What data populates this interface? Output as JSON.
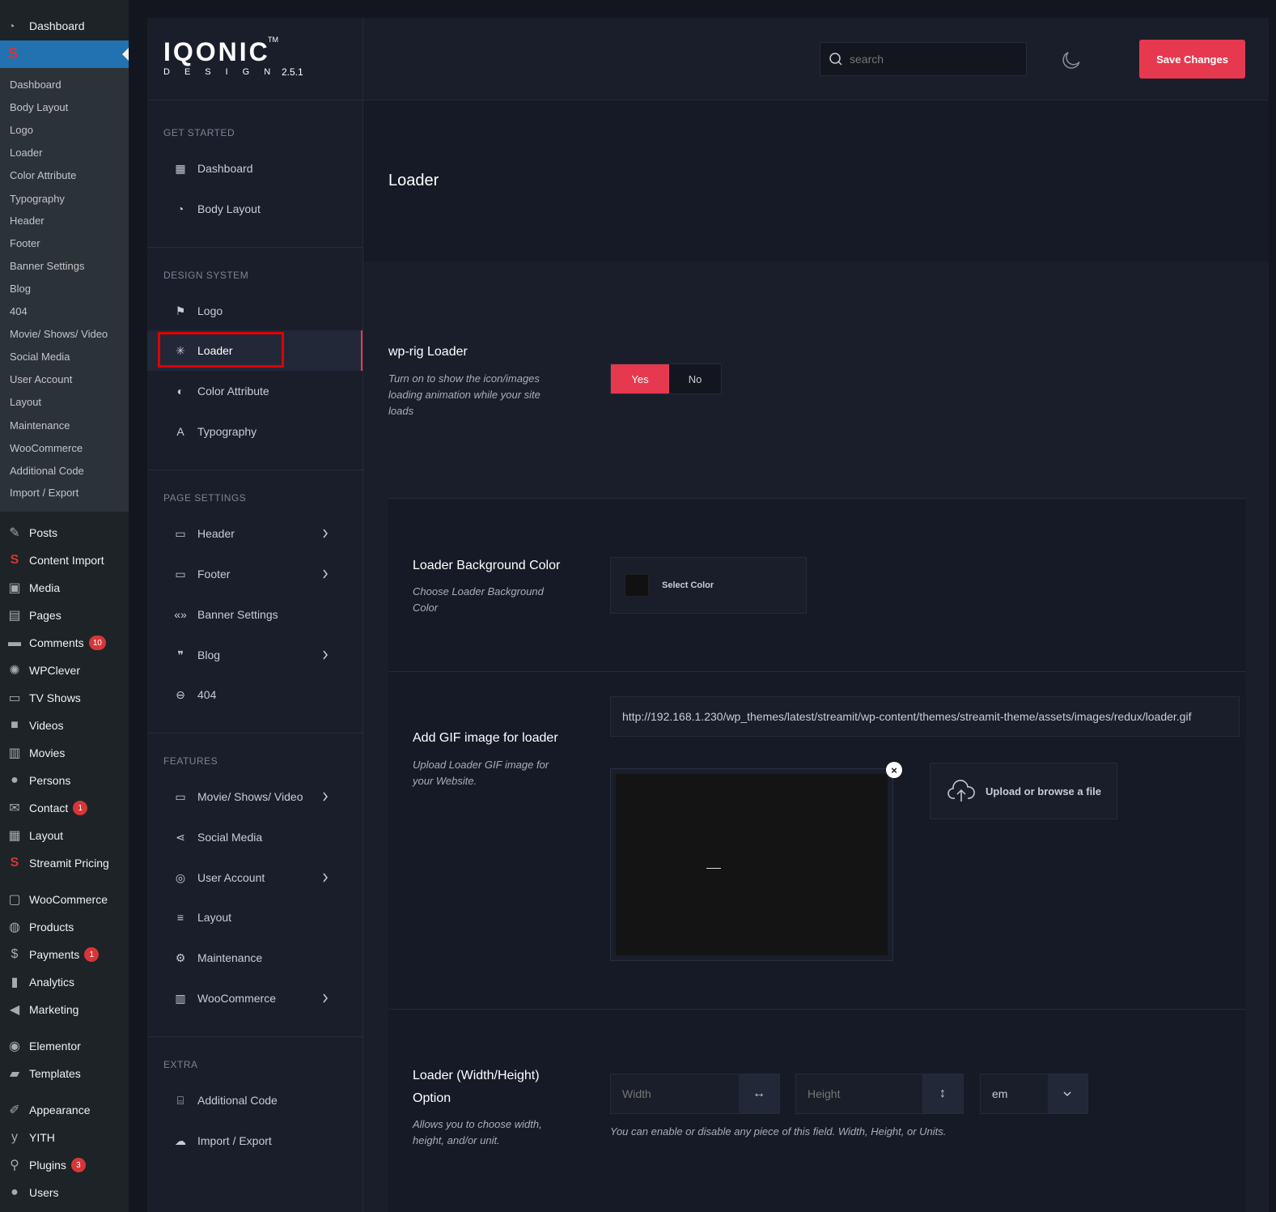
{
  "wp_sidebar": {
    "top_item": "Dashboard",
    "submenu": [
      "Dashboard",
      "Body Layout",
      "Logo",
      "Loader",
      "Color Attribute",
      "Typography",
      "Header",
      "Footer",
      "Banner Settings",
      "Blog",
      "404",
      "Movie/ Shows/ Video",
      "Social Media",
      "User Account",
      "Layout",
      "Maintenance",
      "WooCommerce",
      "Additional Code",
      "Import / Export"
    ],
    "menu": [
      {
        "label": "Posts",
        "icon": "pin-icon"
      },
      {
        "label": "Content Import",
        "icon": "streamit-icon"
      },
      {
        "label": "Media",
        "icon": "media-icon"
      },
      {
        "label": "Pages",
        "icon": "pages-icon"
      },
      {
        "label": "Comments",
        "icon": "comment-icon",
        "badge": "10"
      },
      {
        "label": "WPClever",
        "icon": "bulb-icon"
      },
      {
        "label": "TV Shows",
        "icon": "tv-icon"
      },
      {
        "label": "Videos",
        "icon": "video-icon"
      },
      {
        "label": "Movies",
        "icon": "film-icon"
      },
      {
        "label": "Persons",
        "icon": "person-icon"
      },
      {
        "label": "Contact",
        "icon": "mail-icon",
        "badge": "1"
      },
      {
        "label": "Layout",
        "icon": "layout-icon"
      },
      {
        "label": "Streamit Pricing",
        "icon": "streamit-icon"
      },
      {
        "label": "WooCommerce",
        "icon": "woo-icon"
      },
      {
        "label": "Products",
        "icon": "products-icon"
      },
      {
        "label": "Payments",
        "icon": "payments-icon",
        "badge": "1"
      },
      {
        "label": "Analytics",
        "icon": "analytics-icon"
      },
      {
        "label": "Marketing",
        "icon": "megaphone-icon"
      },
      {
        "label": "Elementor",
        "icon": "elementor-icon"
      },
      {
        "label": "Templates",
        "icon": "folder-icon"
      },
      {
        "label": "Appearance",
        "icon": "brush-icon"
      },
      {
        "label": "YITH",
        "icon": "yith-icon"
      },
      {
        "label": "Plugins",
        "icon": "plugin-icon",
        "badge": "3"
      },
      {
        "label": "Users",
        "icon": "users-icon"
      }
    ]
  },
  "brand": {
    "logo": "IQONIC",
    "tm": "TM",
    "sub": "DESIGN",
    "version": "2.5.1"
  },
  "topbar": {
    "search_placeholder": "search",
    "save_label": "Save Changes"
  },
  "nav": {
    "sections": [
      {
        "heading": "GET STARTED",
        "items": [
          "Dashboard",
          "Body Layout"
        ]
      },
      {
        "heading": "DESIGN SYSTEM",
        "items": [
          "Logo",
          "Loader",
          "Color Attribute",
          "Typography"
        ]
      },
      {
        "heading": "PAGE SETTINGS",
        "items": [
          "Header",
          "Footer",
          "Banner Settings",
          "Blog",
          "404"
        ]
      },
      {
        "heading": "FEATURES",
        "items": [
          "Movie/ Shows/ Video",
          "Social Media",
          "User Account",
          "Layout",
          "Maintenance",
          "WooCommerce"
        ]
      },
      {
        "heading": "EXTRA",
        "items": [
          "Additional Code",
          "Import / Export"
        ]
      }
    ],
    "active": "Loader"
  },
  "page": {
    "title": "Loader"
  },
  "fields": {
    "loader_toggle": {
      "title": "wp-rig Loader",
      "desc": "Turn on to show the icon/images loading animation while your site loads",
      "yes": "Yes",
      "no": "No",
      "selected": "Yes"
    },
    "bg_color": {
      "title": "Loader Background Color",
      "desc": "Choose Loader Background Color",
      "button": "Select Color",
      "swatch": "#111111"
    },
    "gif": {
      "title": "Add GIF image for loader",
      "desc": "Upload Loader GIF image for your Website.",
      "url": "http://192.168.1.230/wp_themes/latest/streamit/wp-content/themes/streamit-theme/assets/images/redux/loader.gif",
      "upload_label": "Upload or browse a file"
    },
    "dimensions": {
      "title_line1": "Loader (Width/Height)",
      "title_line2": "Option",
      "desc": "Allows you to choose width, height, and/or unit.",
      "width_placeholder": "Width",
      "height_placeholder": "Height",
      "unit": "em",
      "note": "You can enable or disable any piece of this field. Width, Height, or Units."
    }
  },
  "colors": {
    "accent": "#e63950",
    "bg": "#13161f",
    "panel": "#1a1e2b"
  }
}
